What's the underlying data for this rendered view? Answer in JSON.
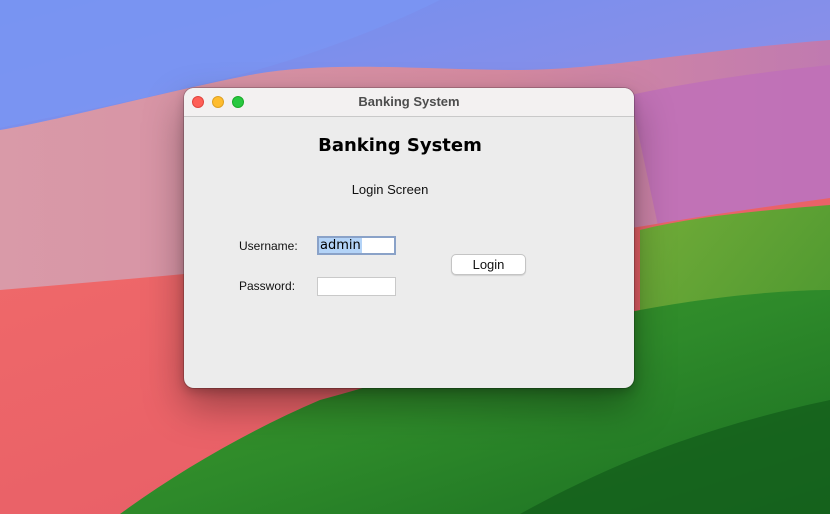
{
  "window": {
    "title": "Banking System"
  },
  "app": {
    "heading": "Banking System",
    "subheading": "Login Screen"
  },
  "form": {
    "username_label": "Username:",
    "username_value": "admin",
    "password_label": "Password:",
    "password_value": "",
    "login_label": "Login"
  },
  "colors": {
    "close": "#fe5f57",
    "minimize": "#febc2e",
    "maximize": "#28c840",
    "selection": "#b3d3f7"
  }
}
